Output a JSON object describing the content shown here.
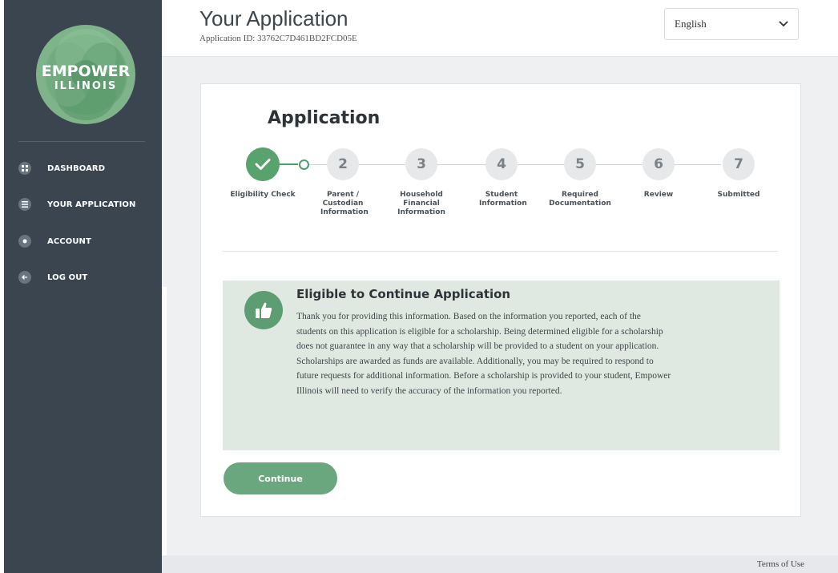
{
  "sidebar": {
    "logo": {
      "line1": "EMPOWER",
      "line2": "ILLINOIS"
    },
    "items": [
      {
        "label": "DASHBOARD",
        "icon": "grid-icon"
      },
      {
        "label": "YOUR APPLICATION",
        "icon": "list-icon"
      },
      {
        "label": "ACCOUNT",
        "icon": "user-icon"
      },
      {
        "label": "LOG OUT",
        "icon": "arrow-left-icon"
      }
    ]
  },
  "header": {
    "title": "Your Application",
    "application_id": "Application ID: 33762C7D461BD2FCD05E",
    "language": {
      "selected": "English",
      "icon": "chevron-down-icon"
    }
  },
  "card": {
    "title": "Application",
    "steps": [
      {
        "number": "",
        "label": "Eligibility Check",
        "state": "complete"
      },
      {
        "number": "2",
        "label": "Parent / Custodian Information",
        "state": "pending"
      },
      {
        "number": "3",
        "label": "Household Financial Information",
        "state": "pending"
      },
      {
        "number": "4",
        "label": "Student Information",
        "state": "pending"
      },
      {
        "number": "5",
        "label": "Required Documentation",
        "state": "pending"
      },
      {
        "number": "6",
        "label": "Review",
        "state": "pending"
      },
      {
        "number": "7",
        "label": "Submitted",
        "state": "pending"
      }
    ]
  },
  "alert": {
    "title": "Eligible to Continue Application",
    "icon": "thumbs-up-icon",
    "body": "Thank you for providing this information. Based on the information you reported, each of the students on this application is eligible for a scholarship. Being determined eligible for a scholarship does not guarantee in any way that a scholarship will be provided to a student on your application. Scholarships are awarded as funds are available. Additionally, you may be required to respond to future requests for additional information. Before a scholarship is provided to your student, Empower Illinois will need to verify the accuracy of the information you reported."
  },
  "actions": {
    "continue_label": "Continue"
  },
  "footer": {
    "terms_label": "Terms of Use"
  },
  "colors": {
    "sidebar": "#3a4550",
    "accent": "#58a26e",
    "alert_bg": "#dfe9e2",
    "button": "#6aa77e"
  }
}
